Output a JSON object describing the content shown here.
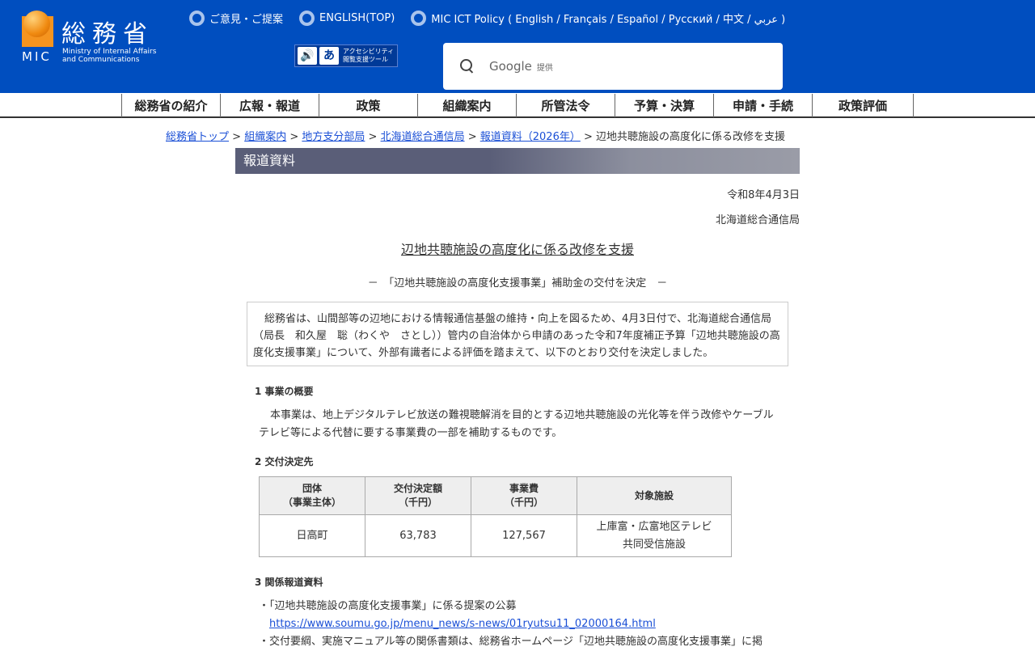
{
  "header": {
    "logo_kanji": "総務省",
    "logo_mic": "MIC",
    "logo_en_1": "Ministry of Internal Affairs",
    "logo_en_2": "and Communications",
    "links": [
      "ご意見・ご提案",
      "ENGLISH(TOP)",
      "MIC ICT Policy ( English / Français / Español / Русский / 中文 / عربي )"
    ],
    "accessibility_text_1": "アクセシビリティ",
    "accessibility_text_2": "閲覧支援ツール",
    "accessibility_icon_2": "あ",
    "search_brand": "Google",
    "search_provided": "提供"
  },
  "nav": [
    "総務省の紹介",
    "広報・報道",
    "政策",
    "組織案内",
    "所管法令",
    "予算・決算",
    "申請・手続",
    "政策評価"
  ],
  "breadcrumb": {
    "items": [
      "総務省トップ",
      "組織案内",
      "地方支分部局",
      "北海道総合通信局",
      "報道資料（2026年）"
    ],
    "current": "辺地共聴施設の高度化に係る改修を支援",
    "sep": " > "
  },
  "section_band": "報道資料",
  "date": "令和8年4月3日",
  "org": "北海道総合通信局",
  "title": "辺地共聴施設の高度化に係る改修を支援",
  "subtitle": "－　「辺地共聴施設の高度化支援事業」補助金の交付を決定　－",
  "lead": "総務省は、山間部等の辺地における情報通信基盤の維持・向上を図るため、4月3日付で、北海道総合通信局（局長　和久屋　聡（わくや　さとし））管内の自治体から申請のあった令和7年度補正予算「辺地共聴施設の高度化支援事業」について、外部有識者による評価を踏まえて、以下のとおり交付を決定しました。",
  "s1_heading": "1 事業の概要",
  "s1_text": "本事業は、地上デジタルテレビ放送の難視聴解消を目的とする辺地共聴施設の光化等を伴う改修やケーブルテレビ等による代替に要する事業費の一部を補助するものです。",
  "s2_heading": "2 交付決定先",
  "table": {
    "headers": [
      [
        "団体",
        "（事業主体）"
      ],
      [
        "交付決定額",
        "（千円）"
      ],
      [
        "事業費",
        "（千円）"
      ],
      [
        "対象施設",
        ""
      ]
    ],
    "row": [
      "日高町",
      "63,783",
      "127,567",
      "上庫富・広富地区テレビ",
      "共同受信施設"
    ]
  },
  "s3_heading": "3 関係報道資料",
  "s3_items": [
    "・「辺地共聴施設の高度化支援事業」に係る提案の公募",
    "https://www.soumu.go.jp/menu_news/s-news/01ryutsu11_02000164.html",
    "・交付要綱、実施マニュアル等の関係書類は、総務省ホームページ「辺地共聴施設の高度化支援事業」に掲"
  ]
}
